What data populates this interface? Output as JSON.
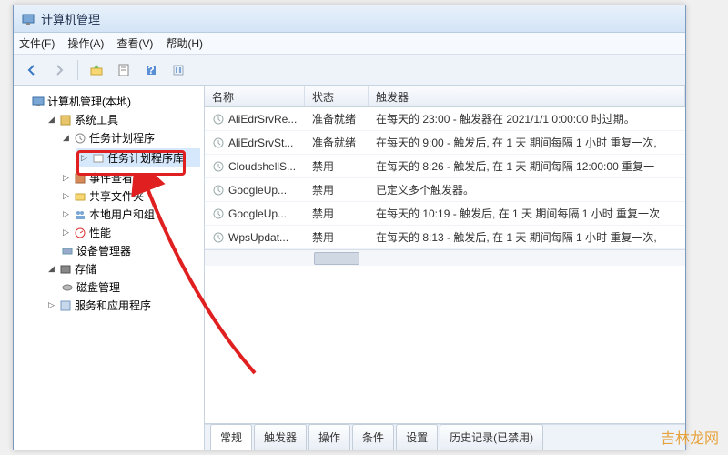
{
  "window": {
    "title": "计算机管理"
  },
  "menu": {
    "file": "文件(F)",
    "action": "操作(A)",
    "view": "查看(V)",
    "help": "帮助(H)"
  },
  "tree": {
    "root": "计算机管理(本地)",
    "system_tools": "系统工具",
    "task_scheduler": "任务计划程序",
    "task_scheduler_library": "任务计划程序库",
    "event_viewer": "事件查看器",
    "shared_folders": "共享文件夹",
    "local_users": "本地用户和组",
    "performance": "性能",
    "device_manager": "设备管理器",
    "storage": "存储",
    "disk_management": "磁盘管理",
    "services_apps": "服务和应用程序"
  },
  "columns": {
    "name": "名称",
    "status": "状态",
    "triggers": "触发器"
  },
  "tasks": [
    {
      "name": "AliEdrSrvRe...",
      "status": "准备就绪",
      "trigger": "在每天的 23:00 - 触发器在 2021/1/1 0:00:00 时过期。"
    },
    {
      "name": "AliEdrSrvSt...",
      "status": "准备就绪",
      "trigger": "在每天的 9:00 - 触发后, 在 1 天 期间每隔 1 小时 重复一次,"
    },
    {
      "name": "CloudshellS...",
      "status": "禁用",
      "trigger": "在每天的 8:26 - 触发后, 在 1 天 期间每隔 12:00:00 重复一"
    },
    {
      "name": "GoogleUp...",
      "status": "禁用",
      "trigger": "已定义多个触发器。"
    },
    {
      "name": "GoogleUp...",
      "status": "禁用",
      "trigger": "在每天的 10:19 - 触发后, 在 1 天 期间每隔 1 小时 重复一次"
    },
    {
      "name": "WpsUpdat...",
      "status": "禁用",
      "trigger": "在每天的 8:13 - 触发后, 在 1 天 期间每隔 1 小时 重复一次,"
    }
  ],
  "tabs": {
    "general": "常规",
    "triggers": "触发器",
    "actions": "操作",
    "conditions": "条件",
    "settings": "设置",
    "history": "历史记录(已禁用)"
  },
  "watermark": "吉林龙网"
}
